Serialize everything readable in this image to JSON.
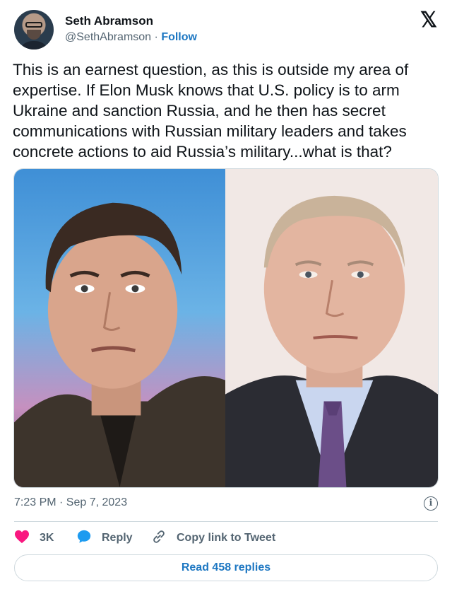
{
  "author": {
    "name": "Seth Abramson",
    "handle": "@SethAbramson",
    "separator": "·",
    "follow_label": "Follow"
  },
  "tweet": {
    "text": "This is an earnest question, as this is outside my area of expertise. If Elon Musk knows that U.S. policy is to arm Ukraine and sanction Russia, and he then has secret communications with Russian military leaders and takes concrete actions to aid Russia’s military...what is that?",
    "timestamp": "7:23 PM · Sep 7, 2023"
  },
  "actions": {
    "like_count": "3K",
    "reply_label": "Reply",
    "copy_label": "Copy link to Tweet"
  },
  "read_replies_label": "Read 458 replies",
  "colors": {
    "text": "#0f1419",
    "secondary": "#536471",
    "link": "#1d77c2",
    "like": "#f91880",
    "reply": "#1d9bf0",
    "border": "#cfd9de"
  },
  "icons": {
    "logo": "x-logo-icon",
    "info": "info-icon",
    "like": "heart-icon",
    "reply": "speech-bubble-icon",
    "copy": "link-icon"
  }
}
